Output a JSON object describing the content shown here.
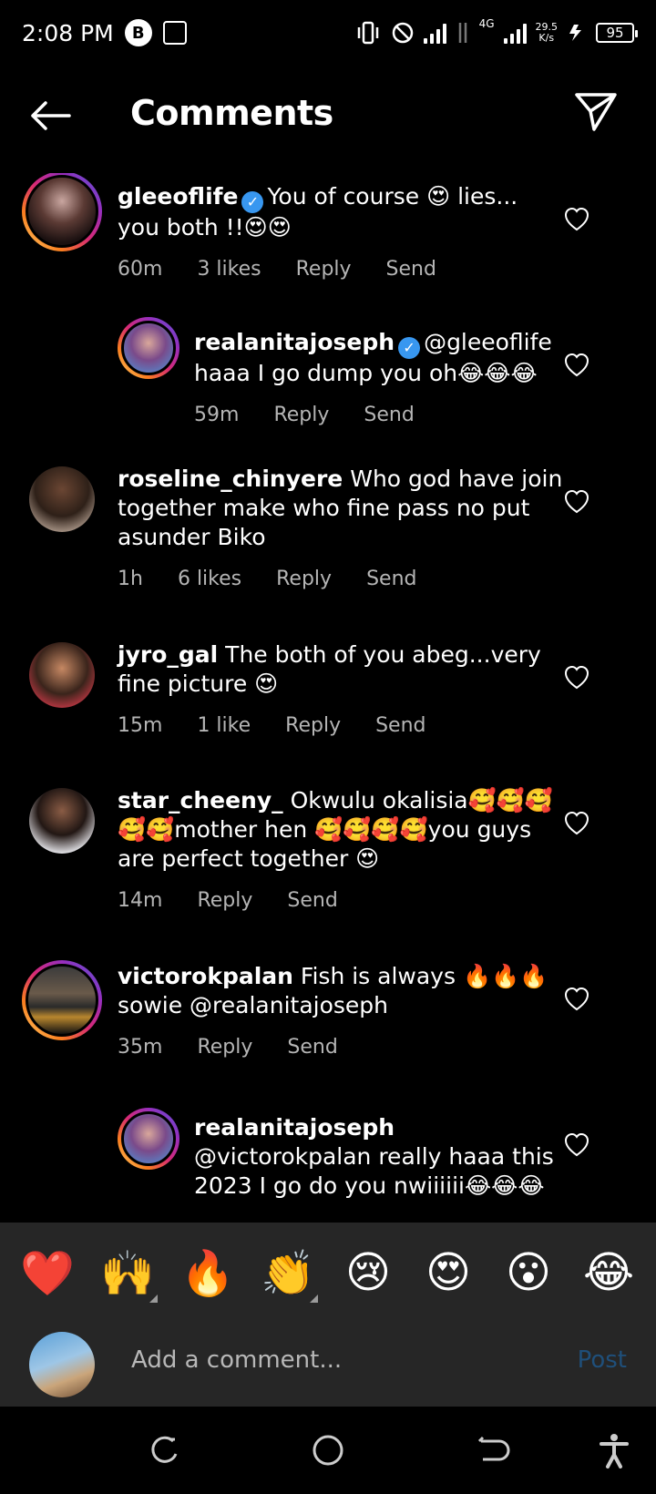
{
  "status": {
    "time": "2:08 PM",
    "badge": "B",
    "net_type": "4G",
    "speed_value": "29.5",
    "speed_unit": "K/s",
    "battery": "95"
  },
  "header": {
    "title": "Comments"
  },
  "comments": [
    {
      "username": "gleeoflife",
      "verified": true,
      "text": "You of course 😍 lies... you both !!😍😍",
      "time": "60m",
      "likes": "3 likes",
      "reply": "Reply",
      "send": "Send"
    },
    {
      "username": "realanitajoseph",
      "verified": true,
      "text": "@gleeoflife haaa I go dump you oh😂😂😂",
      "time": "59m",
      "likes": "",
      "reply": "Reply",
      "send": "Send"
    },
    {
      "username": "roseline_chinyere",
      "verified": false,
      "text": "Who god have join together make who fine pass no put asunder Biko",
      "time": "1h",
      "likes": "6 likes",
      "reply": "Reply",
      "send": "Send"
    },
    {
      "username": "jyro_gal",
      "verified": false,
      "text": "The both of you abeg...very fine picture 😍",
      "time": "15m",
      "likes": "1 like",
      "reply": "Reply",
      "send": "Send"
    },
    {
      "username": "star_cheeny_",
      "verified": false,
      "text": "Okwulu okalisia🥰🥰🥰🥰🥰mother hen 🥰🥰🥰🥰you guys are perfect together 😍",
      "time": "14m",
      "likes": "",
      "reply": "Reply",
      "send": "Send"
    },
    {
      "username": "victorokpalan",
      "verified": false,
      "text": "Fish is always 🔥🔥🔥 sowie @realanitajoseph",
      "time": "35m",
      "likes": "",
      "reply": "Reply",
      "send": "Send"
    },
    {
      "username": "realanitajoseph",
      "verified": false,
      "text": "@victorokpalan really haaa this 2023 I go do you nwiiiiii😂😂😂",
      "time": "",
      "likes": "",
      "reply": "",
      "send": ""
    }
  ],
  "emoji_bar": [
    "❤️",
    "🙌",
    "🔥",
    "👏",
    "😢",
    "😍",
    "😮",
    "😂"
  ],
  "composer": {
    "placeholder": "Add a comment...",
    "post_label": "Post"
  },
  "colors": {
    "accent_blue": "#3897f0",
    "post_disabled": "#1f4f7a",
    "panel": "#262626"
  }
}
